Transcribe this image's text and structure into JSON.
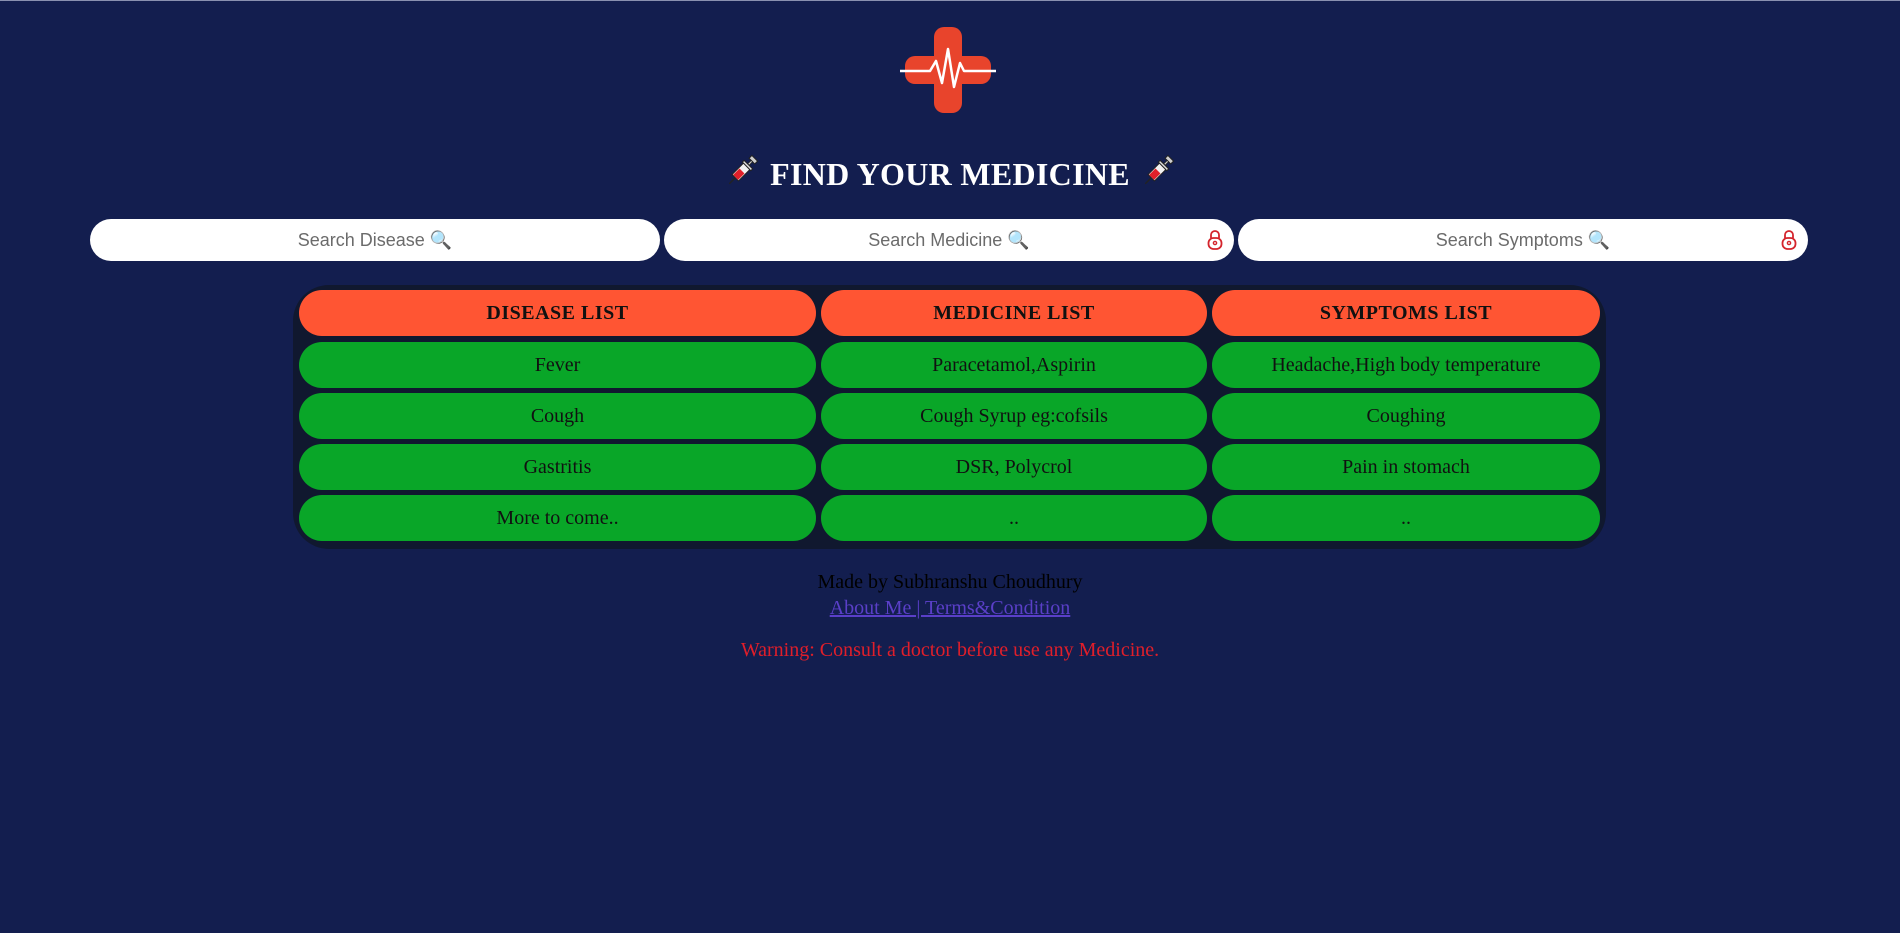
{
  "header": {
    "title": "FIND YOUR MEDICINE",
    "logo_icon": "medical-cross-heartbeat-icon",
    "title_icon": "syringe-icon"
  },
  "search": {
    "disease_placeholder": "Search Disease 🔍",
    "medicine_placeholder": "Search Medicine 🔍",
    "symptoms_placeholder": "Search Symptoms 🔍"
  },
  "table": {
    "headers": [
      "DISEASE LIST",
      "MEDICINE LIST",
      "SYMPTOMS LIST"
    ],
    "rows": [
      [
        "Fever",
        "Paracetamol,Aspirin",
        "Headache,High body temperature"
      ],
      [
        "Cough",
        "Cough Syrup eg:cofsils",
        "Coughing"
      ],
      [
        "Gastritis",
        "DSR, Polycrol",
        "Pain in stomach"
      ],
      [
        "More to come..",
        "..",
        ".."
      ]
    ]
  },
  "footer": {
    "made_by": "Made by Subhranshu Choudhury",
    "links": "About Me | Terms&Condition",
    "warning": "Warning: Consult a doctor before use any Medicine."
  },
  "colors": {
    "background": "#131e4f",
    "header_cell": "#ff5533",
    "body_cell": "#09a628",
    "warning": "#e01e2a",
    "link": "#5a3fc8"
  }
}
